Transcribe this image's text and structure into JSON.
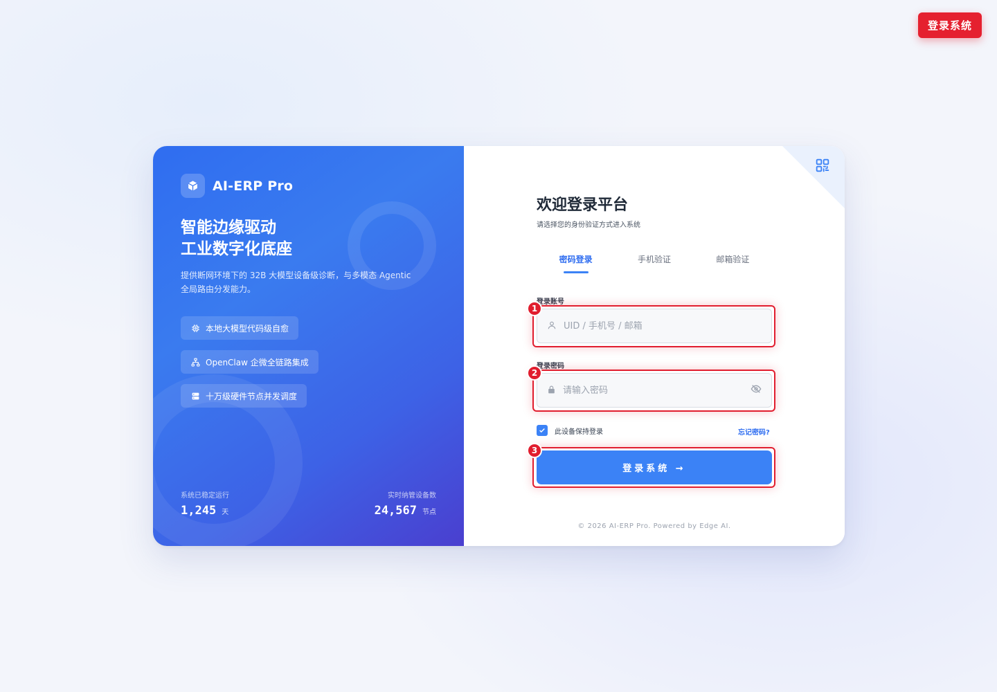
{
  "top_badge": {
    "label": "登录系统"
  },
  "brand": {
    "name": "AI-ERP Pro"
  },
  "hero": {
    "headline_line1": "智能边缘驱动",
    "headline_line2": "工业数字化底座",
    "description_line1": "提供断网环境下的 32B 大模型设备级诊断，与多模态 Agentic",
    "description_line2": "全局路由分发能力。"
  },
  "features": [
    {
      "icon": "chip-icon",
      "label": "本地大模型代码级自愈"
    },
    {
      "icon": "network-icon",
      "label": "OpenClaw 企微全链路集成"
    },
    {
      "icon": "server-icon",
      "label": "十万级硬件节点并发调度"
    }
  ],
  "stats": {
    "uptime": {
      "label": "系统已稳定运行",
      "value": "1,245",
      "unit": "天"
    },
    "devices": {
      "label": "实时纳管设备数",
      "value": "24,567",
      "unit": "节点"
    }
  },
  "login": {
    "title": "欢迎登录平台",
    "subtitle": "请选择您的身份验证方式进入系统",
    "tabs": [
      {
        "label": "密码登录",
        "active": true
      },
      {
        "label": "手机验证",
        "active": false
      },
      {
        "label": "邮箱验证",
        "active": false
      }
    ],
    "account": {
      "label": "登录账号",
      "placeholder": "UID / 手机号 / 邮箱",
      "value": ""
    },
    "password": {
      "label": "登录密码",
      "placeholder": "请输入密码",
      "value": ""
    },
    "remember": {
      "label": "此设备保持登录",
      "checked": true
    },
    "forgot_label": "忘记密码?",
    "submit_label": "登录系统 →",
    "footer": "© 2026 AI-ERP Pro. Powered by Edge AI."
  },
  "markers": [
    "1",
    "2",
    "3"
  ],
  "colors": {
    "accent": "#3b82f6",
    "highlight": "#e11d2e",
    "badge": "#e5202f"
  }
}
